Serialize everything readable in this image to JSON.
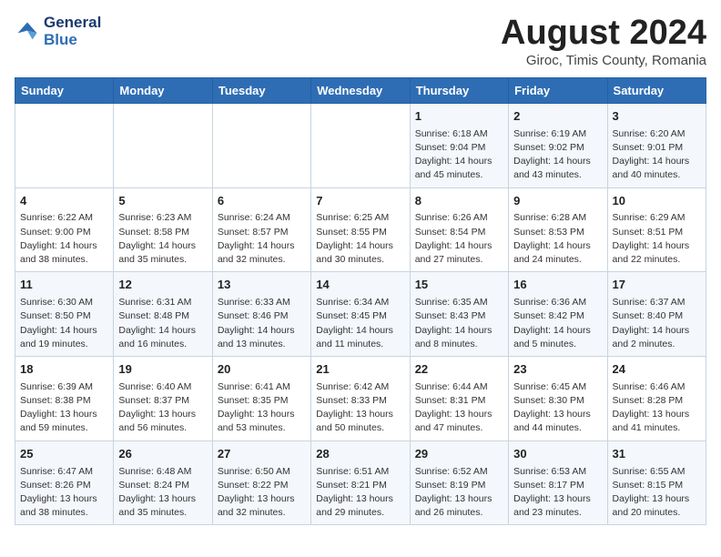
{
  "logo": {
    "line1": "General",
    "line2": "Blue"
  },
  "title": "August 2024",
  "subtitle": "Giroc, Timis County, Romania",
  "days_of_week": [
    "Sunday",
    "Monday",
    "Tuesday",
    "Wednesday",
    "Thursday",
    "Friday",
    "Saturday"
  ],
  "weeks": [
    [
      {
        "day": "",
        "detail": ""
      },
      {
        "day": "",
        "detail": ""
      },
      {
        "day": "",
        "detail": ""
      },
      {
        "day": "",
        "detail": ""
      },
      {
        "day": "1",
        "detail": "Sunrise: 6:18 AM\nSunset: 9:04 PM\nDaylight: 14 hours and 45 minutes."
      },
      {
        "day": "2",
        "detail": "Sunrise: 6:19 AM\nSunset: 9:02 PM\nDaylight: 14 hours and 43 minutes."
      },
      {
        "day": "3",
        "detail": "Sunrise: 6:20 AM\nSunset: 9:01 PM\nDaylight: 14 hours and 40 minutes."
      }
    ],
    [
      {
        "day": "4",
        "detail": "Sunrise: 6:22 AM\nSunset: 9:00 PM\nDaylight: 14 hours and 38 minutes."
      },
      {
        "day": "5",
        "detail": "Sunrise: 6:23 AM\nSunset: 8:58 PM\nDaylight: 14 hours and 35 minutes."
      },
      {
        "day": "6",
        "detail": "Sunrise: 6:24 AM\nSunset: 8:57 PM\nDaylight: 14 hours and 32 minutes."
      },
      {
        "day": "7",
        "detail": "Sunrise: 6:25 AM\nSunset: 8:55 PM\nDaylight: 14 hours and 30 minutes."
      },
      {
        "day": "8",
        "detail": "Sunrise: 6:26 AM\nSunset: 8:54 PM\nDaylight: 14 hours and 27 minutes."
      },
      {
        "day": "9",
        "detail": "Sunrise: 6:28 AM\nSunset: 8:53 PM\nDaylight: 14 hours and 24 minutes."
      },
      {
        "day": "10",
        "detail": "Sunrise: 6:29 AM\nSunset: 8:51 PM\nDaylight: 14 hours and 22 minutes."
      }
    ],
    [
      {
        "day": "11",
        "detail": "Sunrise: 6:30 AM\nSunset: 8:50 PM\nDaylight: 14 hours and 19 minutes."
      },
      {
        "day": "12",
        "detail": "Sunrise: 6:31 AM\nSunset: 8:48 PM\nDaylight: 14 hours and 16 minutes."
      },
      {
        "day": "13",
        "detail": "Sunrise: 6:33 AM\nSunset: 8:46 PM\nDaylight: 14 hours and 13 minutes."
      },
      {
        "day": "14",
        "detail": "Sunrise: 6:34 AM\nSunset: 8:45 PM\nDaylight: 14 hours and 11 minutes."
      },
      {
        "day": "15",
        "detail": "Sunrise: 6:35 AM\nSunset: 8:43 PM\nDaylight: 14 hours and 8 minutes."
      },
      {
        "day": "16",
        "detail": "Sunrise: 6:36 AM\nSunset: 8:42 PM\nDaylight: 14 hours and 5 minutes."
      },
      {
        "day": "17",
        "detail": "Sunrise: 6:37 AM\nSunset: 8:40 PM\nDaylight: 14 hours and 2 minutes."
      }
    ],
    [
      {
        "day": "18",
        "detail": "Sunrise: 6:39 AM\nSunset: 8:38 PM\nDaylight: 13 hours and 59 minutes."
      },
      {
        "day": "19",
        "detail": "Sunrise: 6:40 AM\nSunset: 8:37 PM\nDaylight: 13 hours and 56 minutes."
      },
      {
        "day": "20",
        "detail": "Sunrise: 6:41 AM\nSunset: 8:35 PM\nDaylight: 13 hours and 53 minutes."
      },
      {
        "day": "21",
        "detail": "Sunrise: 6:42 AM\nSunset: 8:33 PM\nDaylight: 13 hours and 50 minutes."
      },
      {
        "day": "22",
        "detail": "Sunrise: 6:44 AM\nSunset: 8:31 PM\nDaylight: 13 hours and 47 minutes."
      },
      {
        "day": "23",
        "detail": "Sunrise: 6:45 AM\nSunset: 8:30 PM\nDaylight: 13 hours and 44 minutes."
      },
      {
        "day": "24",
        "detail": "Sunrise: 6:46 AM\nSunset: 8:28 PM\nDaylight: 13 hours and 41 minutes."
      }
    ],
    [
      {
        "day": "25",
        "detail": "Sunrise: 6:47 AM\nSunset: 8:26 PM\nDaylight: 13 hours and 38 minutes."
      },
      {
        "day": "26",
        "detail": "Sunrise: 6:48 AM\nSunset: 8:24 PM\nDaylight: 13 hours and 35 minutes."
      },
      {
        "day": "27",
        "detail": "Sunrise: 6:50 AM\nSunset: 8:22 PM\nDaylight: 13 hours and 32 minutes."
      },
      {
        "day": "28",
        "detail": "Sunrise: 6:51 AM\nSunset: 8:21 PM\nDaylight: 13 hours and 29 minutes."
      },
      {
        "day": "29",
        "detail": "Sunrise: 6:52 AM\nSunset: 8:19 PM\nDaylight: 13 hours and 26 minutes."
      },
      {
        "day": "30",
        "detail": "Sunrise: 6:53 AM\nSunset: 8:17 PM\nDaylight: 13 hours and 23 minutes."
      },
      {
        "day": "31",
        "detail": "Sunrise: 6:55 AM\nSunset: 8:15 PM\nDaylight: 13 hours and 20 minutes."
      }
    ]
  ]
}
